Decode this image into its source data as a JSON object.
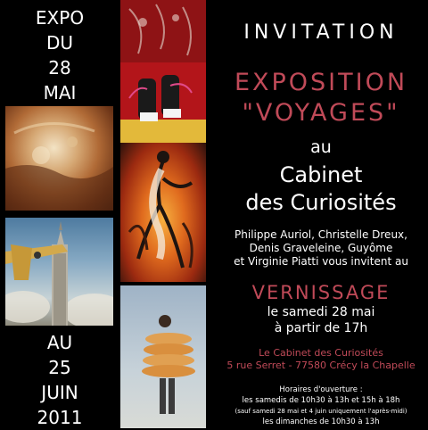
{
  "date_top": [
    "EXPO",
    "DU",
    "28",
    "MAI"
  ],
  "date_bottom": [
    "AU",
    "25",
    "JUIN",
    "2011"
  ],
  "invitation": "INVITATION",
  "exposition": {
    "line1": "EXPOSITION",
    "line2": "\"VOYAGES\""
  },
  "venue": {
    "au": "au",
    "line1": "Cabinet",
    "line2": "des Curiosités"
  },
  "artists": [
    "Philippe Auriol, Christelle Dreux,",
    "Denis Graveleine, Guyôme",
    "et Virginie Piatti vous invitent au"
  ],
  "vernissage": {
    "title": "VERNISSAGE",
    "line1": "le samedi 28 mai",
    "line2": "à partir de 17h"
  },
  "address": {
    "line1": "Le Cabinet des Curiosités",
    "line2": "5 rue Serret - 77580 Crécy la Chapelle"
  },
  "hours": {
    "title": "Horaires d'ouverture :",
    "line1": "les samedis de 10h30 à 13h et 15h à 18h",
    "note": "(sauf samedi 28 mai et 4 juin uniquement l'après-midi)",
    "line2": "les dimanches de 10h30 à 13h"
  },
  "colors": {
    "background": "#000000",
    "accent": "#c04a58",
    "text": "#ffffff"
  }
}
